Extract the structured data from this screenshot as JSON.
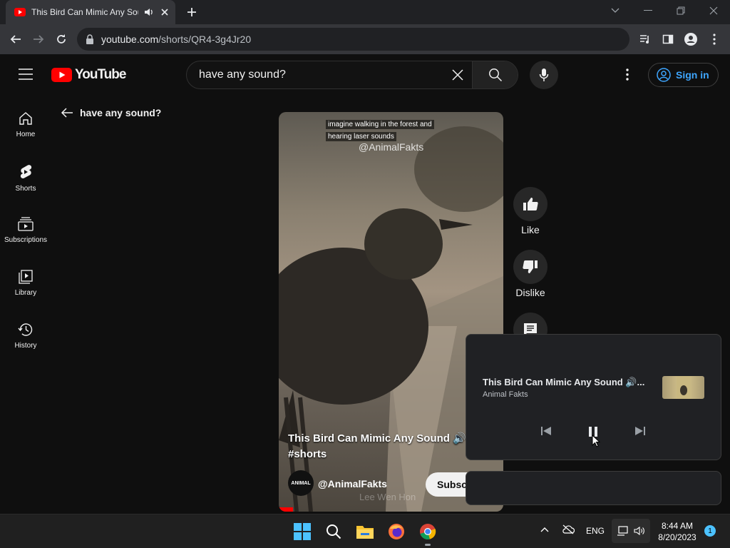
{
  "browser": {
    "tab_title": "This Bird Can Mimic Any Sou",
    "url_host": "youtube.com",
    "url_path": "/shorts/QR4-3g4Jr20"
  },
  "youtube": {
    "logo_text": "YouTube",
    "search_value": "have any sound?",
    "signin_label": "Sign in",
    "back_query": "have any sound?"
  },
  "sidebar": {
    "items": [
      {
        "label": "Home",
        "icon": "home-icon"
      },
      {
        "label": "Shorts",
        "icon": "shorts-icon"
      },
      {
        "label": "Subscriptions",
        "icon": "subscriptions-icon"
      },
      {
        "label": "Library",
        "icon": "library-icon"
      },
      {
        "label": "History",
        "icon": "history-icon"
      }
    ]
  },
  "short": {
    "caption_line1": "imagine walking in the forest and",
    "caption_line2": "hearing laser sounds",
    "watermark": "@AnimalFakts",
    "title_line1": "This Bird Can Mimic Any Sound 🔊",
    "title_line2": "#shorts",
    "channel": "@AnimalFakts",
    "avatar_text": "ANIMAL",
    "subscribe_label": "Subsc",
    "credit": "Lee Wen Hon"
  },
  "actions": {
    "like_label": "Like",
    "dislike_label": "Dislike"
  },
  "media_popup": {
    "title": "This Bird Can Mimic Any Sound 🔊...",
    "artist": "Animal Fakts"
  },
  "taskbar": {
    "language": "ENG",
    "time": "8:44 AM",
    "date": "8/20/2023",
    "notification_count": "1"
  },
  "colors": {
    "youtube_red": "#ff0000",
    "signin_blue": "#3ea6ff",
    "background": "#0f0f0f"
  }
}
